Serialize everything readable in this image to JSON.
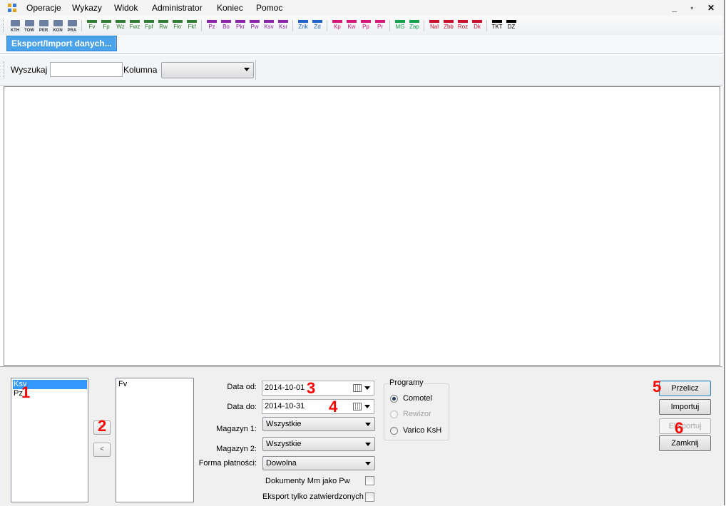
{
  "menu": {
    "items": [
      "Operacje",
      "Wykazy",
      "Widok",
      "Administrator",
      "Koniec",
      "Pomoc"
    ],
    "window_controls": "_ ▫ ✕"
  },
  "toolbar": {
    "icon_buttons": [
      "KTH",
      "TOW",
      "PER",
      "KON",
      "PRA"
    ],
    "groups": [
      {
        "color": "#2e7d32",
        "labels": [
          "Fv",
          "Fp",
          "Wz",
          "Fwz",
          "Fpf",
          "Rw",
          "Fkr",
          "Fkf"
        ]
      },
      {
        "color": "#8e24aa",
        "labels": [
          "Pz",
          "Bo",
          "Pkr",
          "Pw",
          "Ksv",
          "Ksr"
        ]
      },
      {
        "color": "#1e63c6",
        "labels": [
          "Znk",
          "Zd"
        ]
      },
      {
        "color": "#d6187b",
        "labels": [
          "Kp",
          "Kw",
          "Pp",
          "Pr"
        ]
      },
      {
        "color": "#12a04a",
        "labels": [
          "MG",
          "Zap"
        ]
      },
      {
        "color": "#c8102e",
        "labels": [
          "Nal",
          "Zbb",
          "Roz",
          "Dk"
        ]
      },
      {
        "color": "#000000",
        "labels": [
          "TKT",
          "DZ"
        ]
      }
    ]
  },
  "tabs": {
    "active": "Eksport/Import danych..."
  },
  "search": {
    "label": "Wyszukaj",
    "value": "",
    "column_label": "Kolumna",
    "column_value": ""
  },
  "lists": {
    "left_items": [
      "Ksv",
      "Pz"
    ],
    "left_selected_index": 0,
    "right_items": [
      "Fv"
    ],
    "move_right": ">",
    "move_left": "<"
  },
  "form": {
    "date_from_label": "Data od:",
    "date_from": "2014-10-01",
    "date_to_label": "Data do:",
    "date_to": "2014-10-31",
    "warehouse1_label": "Magazyn 1:",
    "warehouse1": "Wszystkie",
    "warehouse2_label": "Magazyn 2:",
    "warehouse2": "Wszystkie",
    "payment_label": "Forma płatności:",
    "payment": "Dowolna",
    "mm_as_pw_label": "Dokumenty Mm jako Pw",
    "mm_as_pw_checked": false,
    "approved_only_label": "Eksport tylko zatwierdzonych",
    "approved_only_checked": false
  },
  "programs": {
    "title": "Programy",
    "options": [
      {
        "label": "Comotel",
        "checked": true,
        "disabled": false
      },
      {
        "label": "Rewizor",
        "checked": false,
        "disabled": true
      },
      {
        "label": "Varico KsH",
        "checked": false,
        "disabled": false
      }
    ]
  },
  "actions": {
    "recalc": "Przelicz",
    "import": "Importuj",
    "export": "Eksportuj",
    "close": "Zamknij"
  },
  "markers": [
    "1",
    "2",
    "3",
    "4",
    "5",
    "6"
  ]
}
